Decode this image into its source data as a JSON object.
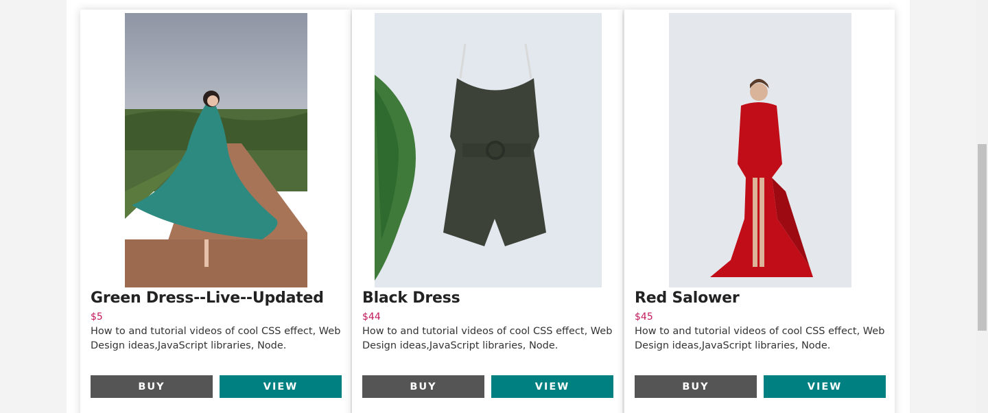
{
  "products": [
    {
      "title": "Green Dress--Live--Updated",
      "price": "$5",
      "description": "How to and tutorial videos of cool CSS effect, Web Design ideas,JavaScript libraries, Node.",
      "buy_label": "BUY",
      "view_label": "VIEW"
    },
    {
      "title": "Black Dress",
      "price": "$44",
      "description": "How to and tutorial videos of cool CSS effect, Web Design ideas,JavaScript libraries, Node.",
      "buy_label": "BUY",
      "view_label": "VIEW"
    },
    {
      "title": "Red Salower",
      "price": "$45",
      "description": "How to and tutorial videos of cool CSS effect, Web Design ideas,JavaScript libraries, Node.",
      "buy_label": "BUY",
      "view_label": "VIEW"
    }
  ],
  "colors": {
    "buy_button": "#555555",
    "view_button": "#008080",
    "price": "#c2185b",
    "title": "#222222"
  }
}
